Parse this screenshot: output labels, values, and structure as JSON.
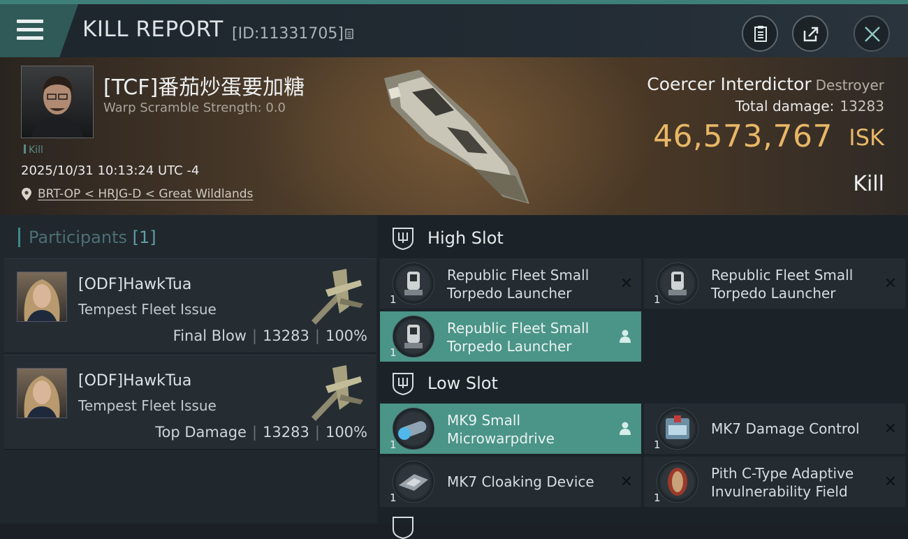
{
  "header": {
    "title": "KILL REPORT",
    "report_id": "[ID:11331705]"
  },
  "victim": {
    "name": "[TCF]番茄炒蛋要加糖",
    "warp_scramble": "Warp Scramble Strength: 0.0",
    "tag": "Kill",
    "datetime": "2025/10/31 10:13:24 UTC -4",
    "location": "BRT-OP < HRJG-D < Great Wildlands"
  },
  "ship": {
    "name": "Coercer Interdictor",
    "class": "Destroyer",
    "total_damage_label": "Total damage:",
    "total_damage": "13283",
    "isk_value": "46,573,767",
    "isk_unit": "ISK",
    "type": "Kill"
  },
  "participants": {
    "label": "Participants",
    "count": "[1]",
    "items": [
      {
        "name": "[ODF]HawkTua",
        "ship": "Tempest Fleet Issue",
        "role": "Final Blow",
        "damage": "13283",
        "percent": "100%"
      },
      {
        "name": "[ODF]HawkTua",
        "ship": "Tempest Fleet Issue",
        "role": "Top Damage",
        "damage": "13283",
        "percent": "100%"
      }
    ]
  },
  "fitting": {
    "high_slot": {
      "label": "High Slot",
      "modules": [
        {
          "name_line1": "Republic Fleet Small",
          "name_line2": "Torpedo Launcher",
          "qty": "1",
          "state": "destroyed"
        },
        {
          "name_line1": "Republic Fleet Small",
          "name_line2": "Torpedo Launcher",
          "qty": "1",
          "state": "destroyed"
        },
        {
          "name_line1": "Republic Fleet Small",
          "name_line2": "Torpedo Launcher",
          "qty": "1",
          "state": "dropped"
        }
      ]
    },
    "low_slot": {
      "label": "Low Slot",
      "modules": [
        {
          "name_line1": "MK9 Small",
          "name_line2": "Microwarpdrive",
          "qty": "1",
          "state": "dropped"
        },
        {
          "name_line1": "MK7 Damage Control",
          "name_line2": "",
          "qty": "1",
          "state": "destroyed"
        },
        {
          "name_line1": "MK7 Cloaking Device",
          "name_line2": "",
          "qty": "1",
          "state": "destroyed"
        },
        {
          "name_line1": "Pith C-Type Adaptive",
          "name_line2": "Invulnerability Field",
          "qty": "1",
          "state": "destroyed"
        }
      ]
    }
  },
  "colors": {
    "accent": "#4b9488",
    "isk": "#e8b766",
    "topbar_stripe": "#3f7f7a"
  },
  "icons": [
    "menu-icon",
    "copy-icon",
    "clipboard-icon",
    "share-icon",
    "close-icon",
    "location-pin-icon",
    "shield-slot-icon",
    "person-icon",
    "x-icon"
  ]
}
